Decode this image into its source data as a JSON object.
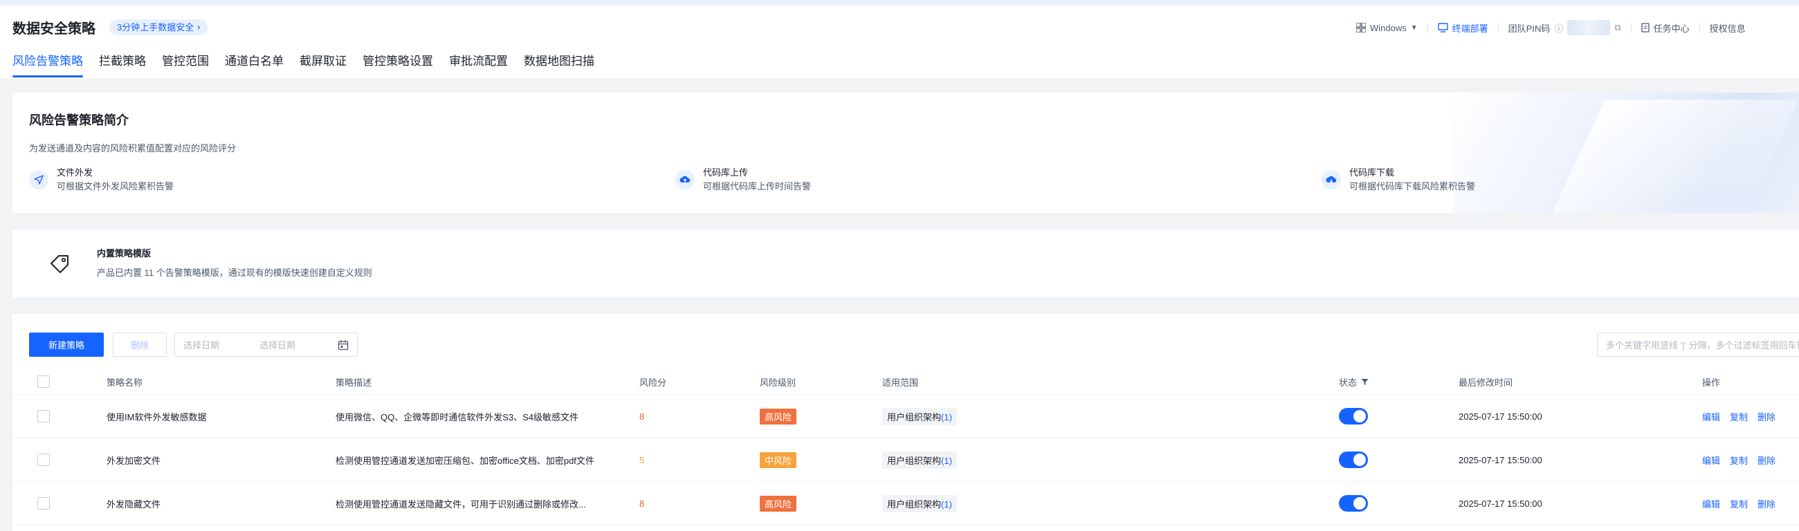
{
  "header": {
    "title": "数据安全策略",
    "quick_badge": "3分钟上手数据安全",
    "os_label": "Windows",
    "deploy_label": "终端部署",
    "pin_label": "团队PIN码",
    "task_center": "任务中心",
    "auth_label": "授权信息"
  },
  "tabs": [
    "风险告警策略",
    "拦截策略",
    "管控范围",
    "通道白名单",
    "截屏取证",
    "管控策略设置",
    "审批流配置",
    "数据地图扫描"
  ],
  "intro": {
    "title": "风险告警策略简介",
    "desc": "为发送通道及内容的风险积累值配置对应的风险评分",
    "features": [
      {
        "title": "文件外发",
        "sub": "可根据文件外发风险累积告警",
        "icon": "send-icon"
      },
      {
        "title": "代码库上传",
        "sub": "可根据代码库上传时间告警",
        "icon": "cloud-upload-icon"
      },
      {
        "title": "代码库下载",
        "sub": "可根据代码库下载风险累积告警",
        "icon": "cloud-download-icon"
      }
    ]
  },
  "template": {
    "title": "内置策略模版",
    "desc": "产品已内置 11 个告警策略模版，通过现有的模版快速创建自定义规则"
  },
  "toolbar": {
    "new_label": "新建策略",
    "delete_label": "删除",
    "date_start_placeholder": "选择日期",
    "date_end_placeholder": "选择日期",
    "search_placeholder": "多个关键字用竖线 '|' 分隔，多个过滤标签用回车键分隔"
  },
  "table": {
    "headers": {
      "name": "策略名称",
      "desc": "策略描述",
      "score": "风险分",
      "level": "风险级别",
      "scope": "适用范围",
      "status": "状态",
      "time": "最后修改时间",
      "ops": "操作"
    },
    "rows": [
      {
        "name": "使用IM软件外发敏感数据",
        "desc": "使用微信、QQ、企微等即时通信软件外发S3、S4级敏感文件",
        "score": "8",
        "level": "高风险",
        "scope": "用户组织架构",
        "scope_count": "(1)",
        "status": "on",
        "time": "2025-07-17 15:50:00"
      },
      {
        "name": "外发加密文件",
        "desc": "检测使用管控通道发送加密压缩包、加密office文档、加密pdf文件",
        "score": "5",
        "level": "中风险",
        "scope": "用户组织架构",
        "scope_count": "(1)",
        "status": "on",
        "time": "2025-07-17 15:50:00"
      },
      {
        "name": "外发隐藏文件",
        "desc": "检测使用管控通道发送隐藏文件，可用于识别通过删除或修改...",
        "score": "8",
        "level": "高风险",
        "scope": "用户组织架构",
        "scope_count": "(1)",
        "status": "on",
        "time": "2025-07-17 15:50:00"
      }
    ],
    "ops": [
      "编辑",
      "复制",
      "删除"
    ]
  }
}
